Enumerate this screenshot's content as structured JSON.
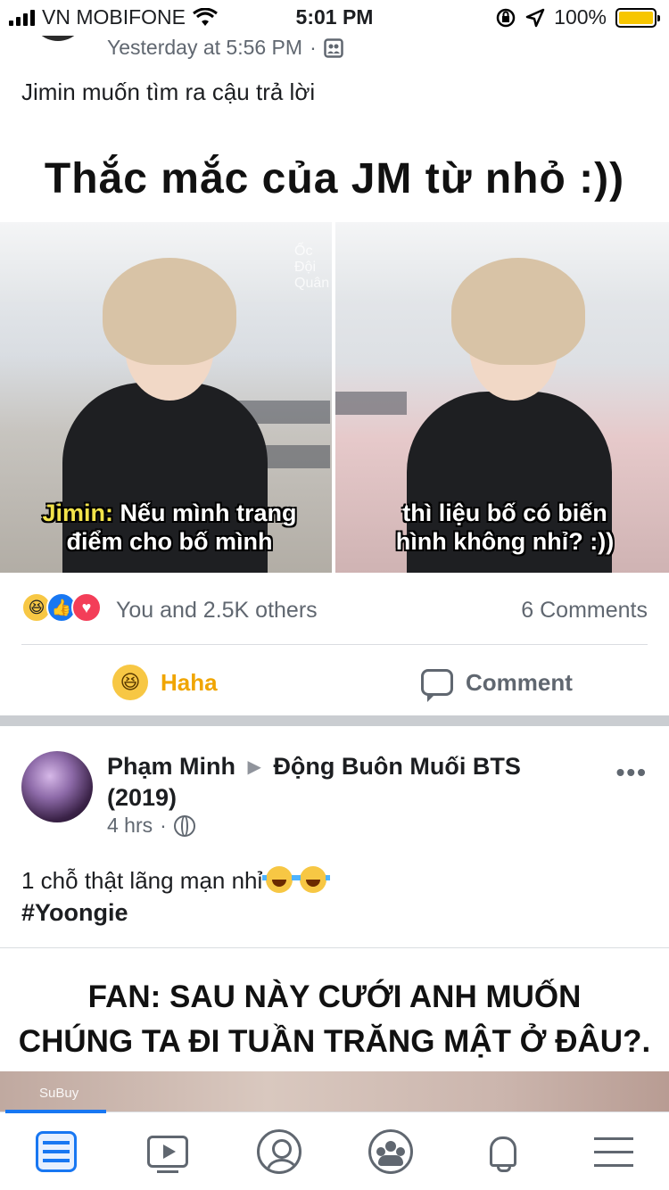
{
  "status_bar": {
    "carrier": "VN MOBIFONE",
    "time": "5:01 PM",
    "battery_percent": "100%",
    "battery_level": 1.0
  },
  "post1": {
    "timestamp": "Yesterday at 5:56 PM",
    "separator": "·",
    "text": "Jimin muốn tìm ra cậu trả lời",
    "image": {
      "title": "Thắc mắc của JM từ nhỏ :))",
      "watermark": "Ốc Đội Quân",
      "caption_left_speaker": "Jimin:",
      "caption_left_line1": "Nếu mình trang",
      "caption_left_line2": "điểm cho bố mình",
      "caption_right_line1": "thì liệu bố có biến",
      "caption_right_line2": "hình không nhỉ? :))"
    },
    "reactions_text": "You and 2.5K others",
    "comments_count": "6 Comments",
    "action_haha": "Haha",
    "action_comment": "Comment",
    "accent_haha": "#f0a500"
  },
  "post2": {
    "author": "Phạm Minh",
    "group": "Động Buôn Muối BTS (2019)",
    "time": "4 hrs",
    "separator": "·",
    "text": "1 chỗ thật lãng mạn nhỉ",
    "hashtag": "#Yoongie",
    "image": {
      "title_line1": "FAN: SAU NÀY CƯỚI ANH MUỐN",
      "title_line2": "CHÚNG TA ĐI TUẦN TRĂNG MẬT Ở ĐÂU?.",
      "watermark": "SuBuy"
    }
  },
  "tab_bar": {
    "active_color": "#1877f2",
    "inactive_color": "#606770",
    "tabs": [
      "newsfeed-icon",
      "watch-icon",
      "profile-icon",
      "groups-icon",
      "notifications-icon",
      "menu-icon"
    ]
  }
}
